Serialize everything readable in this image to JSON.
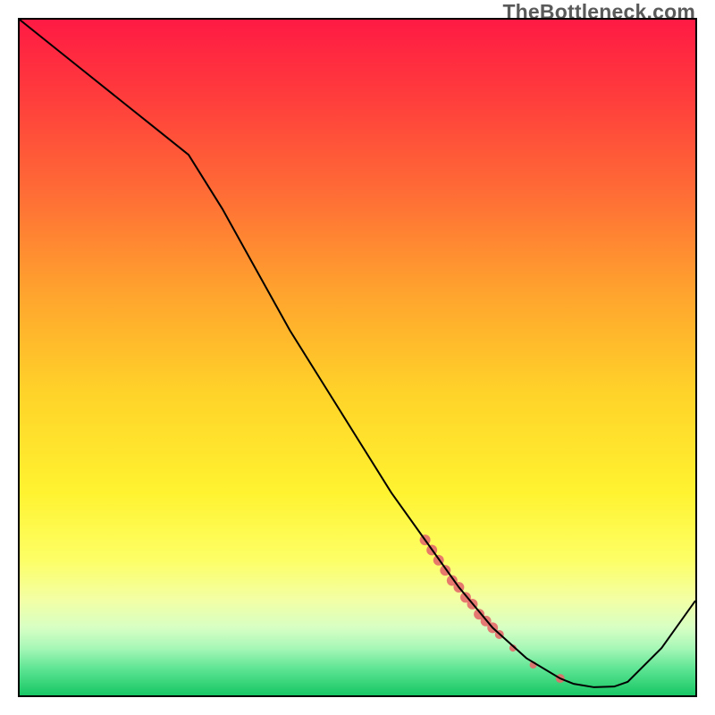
{
  "watermark": "TheBottleneck.com",
  "chart_data": {
    "type": "line",
    "title": "",
    "xlabel": "",
    "ylabel": "",
    "xlim": [
      0,
      100
    ],
    "ylim": [
      0,
      100
    ],
    "grid": false,
    "background": {
      "type": "vertical-gradient",
      "stops": [
        {
          "offset": 0.0,
          "color": "#ff1a44"
        },
        {
          "offset": 0.1,
          "color": "#ff383d"
        },
        {
          "offset": 0.25,
          "color": "#ff6a36"
        },
        {
          "offset": 0.4,
          "color": "#ffa22e"
        },
        {
          "offset": 0.55,
          "color": "#ffd229"
        },
        {
          "offset": 0.7,
          "color": "#fff330"
        },
        {
          "offset": 0.8,
          "color": "#fdff66"
        },
        {
          "offset": 0.86,
          "color": "#f2ffa6"
        },
        {
          "offset": 0.9,
          "color": "#d7ffc4"
        },
        {
          "offset": 0.93,
          "color": "#a7f7b7"
        },
        {
          "offset": 0.96,
          "color": "#5fe595"
        },
        {
          "offset": 1.0,
          "color": "#17c764"
        }
      ]
    },
    "series": [
      {
        "name": "bottleneck-curve",
        "color": "#000000",
        "width": 2,
        "x": [
          0,
          5,
          10,
          15,
          20,
          25,
          30,
          35,
          40,
          45,
          50,
          55,
          60,
          65,
          70,
          75,
          80,
          82,
          85,
          88,
          90,
          95,
          100
        ],
        "y": [
          100,
          96,
          92,
          88,
          84,
          80,
          72,
          63,
          54,
          46,
          38,
          30,
          23,
          16,
          10,
          5.5,
          2.5,
          1.7,
          1.2,
          1.3,
          2.0,
          7,
          14
        ]
      }
    ],
    "highlight_band": {
      "name": "sweet-spot-markers",
      "color": "#e46a6a",
      "x": [
        60,
        61,
        62,
        63,
        64,
        65,
        66,
        67,
        68,
        69,
        70,
        71,
        73,
        76,
        80
      ],
      "y": [
        23,
        21.5,
        20,
        18.5,
        17,
        16,
        14.5,
        13.5,
        12,
        11,
        10,
        9,
        7,
        4.5,
        2.5
      ],
      "r": [
        6,
        6,
        6,
        6,
        6,
        6,
        6,
        6,
        6,
        6,
        6,
        5,
        4,
        4,
        5
      ]
    }
  }
}
